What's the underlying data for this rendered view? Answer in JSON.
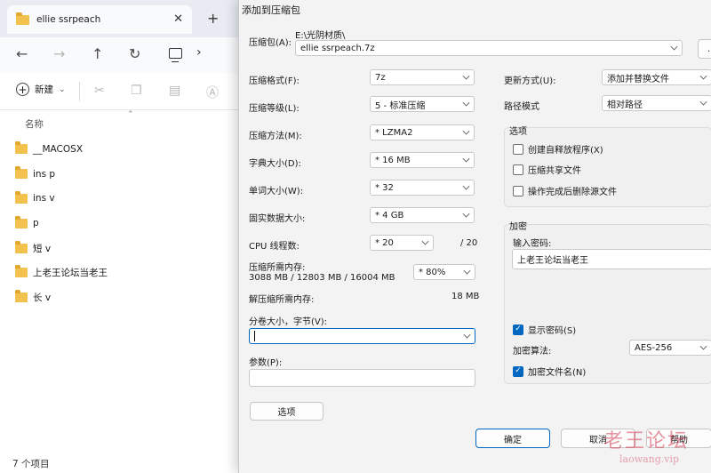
{
  "explorer": {
    "tab_title": "ellie  ssrpeach",
    "tab_close": "✕",
    "new_tab": "+",
    "new_button_label": "新建",
    "column_name": "名称",
    "files": [
      "__MACOSX",
      "ins p",
      "ins v",
      "p",
      "短 v",
      "上老王论坛当老王",
      "长  v"
    ],
    "status": "7 个项目"
  },
  "dialog": {
    "title": "添加到压缩包",
    "archive": {
      "label": "压缩包(A):",
      "path": "E:\\光阴材质\\",
      "name": "ellie  ssrpeach.7z",
      "browse": "..."
    },
    "format": {
      "label": "压缩格式(F):",
      "value": "7z"
    },
    "level": {
      "label": "压缩等级(L):",
      "value": "5 - 标准压缩"
    },
    "method": {
      "label": "压缩方法(M):",
      "value": "*  LZMA2"
    },
    "dict": {
      "label": "字典大小(D):",
      "value": "*  16 MB"
    },
    "word": {
      "label": "单词大小(W):",
      "value": "*  32"
    },
    "solid": {
      "label": "固实数据大小:",
      "value": "*  4 GB"
    },
    "threads": {
      "label": "CPU 线程数:",
      "value": "*  20",
      "max": "/ 20"
    },
    "memory": {
      "label": "压缩所需内存:",
      "detail": "3088 MB / 12803 MB / 16004 MB",
      "percent": "* 80%"
    },
    "decomp_memory": {
      "label": "解压缩所需内存:",
      "value": "18 MB"
    },
    "split": {
      "label": "分卷大小，字节(V):",
      "value": ""
    },
    "params": {
      "label": "参数(P):",
      "value": ""
    },
    "options_button": "选项",
    "update": {
      "label": "更新方式(U):",
      "value": "添加并替换文件"
    },
    "path_mode": {
      "label": "路径模式",
      "value": "相对路径"
    },
    "options_group": {
      "title": "选项",
      "sfx": "创建自释放程序(X)",
      "shared": "压缩共享文件",
      "delete": "操作完成后删除源文件"
    },
    "encryption": {
      "title": "加密",
      "password_label": "输入密码:",
      "password": "上老王论坛当老王",
      "show_password": "显示密码(S)",
      "show_password_checked": true,
      "method_label": "加密算法:",
      "method": "AES-256",
      "encrypt_names": "加密文件名(N)",
      "encrypt_names_checked": true
    },
    "ok": "确定",
    "cancel": "取消",
    "help": "帮助"
  },
  "watermark": {
    "main": "老王论坛",
    "sub": "laowang.vip"
  }
}
